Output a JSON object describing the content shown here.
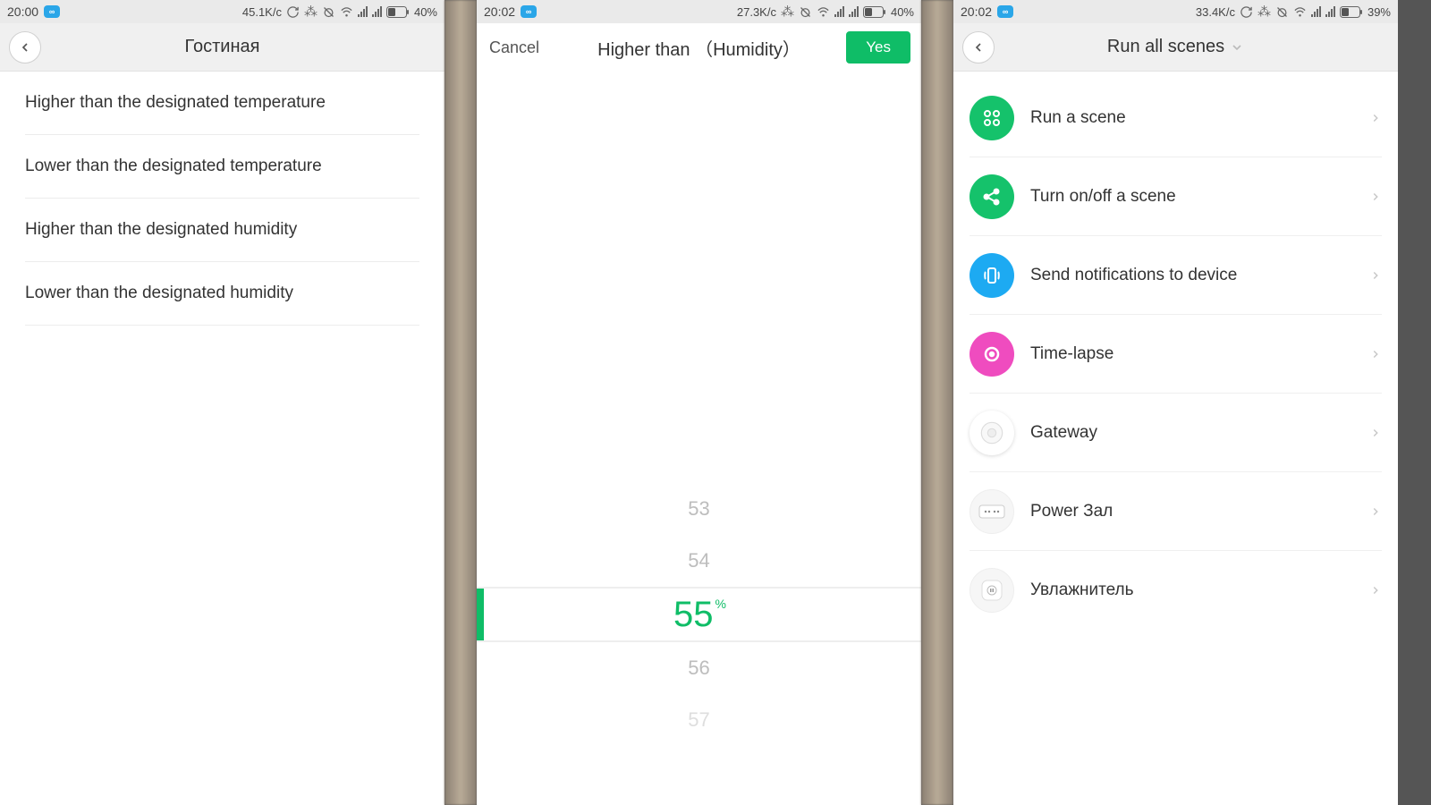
{
  "screen1": {
    "status": {
      "time": "20:00",
      "speed": "45.1K/c",
      "battery": "40%"
    },
    "title": "Гостиная",
    "options": [
      "Higher than the designated temperature",
      "Lower than the designated temperature",
      "Higher than the designated humidity",
      "Lower than the designated humidity"
    ]
  },
  "screen2": {
    "status": {
      "time": "20:02",
      "speed": "27.3K/c",
      "battery": "40%"
    },
    "cancel": "Cancel",
    "title": "Higher than （Humidity）",
    "confirm": "Yes",
    "picker": {
      "unit": "%",
      "values_above": [
        "53",
        "54"
      ],
      "selected": "55",
      "values_below": [
        "56",
        "57"
      ]
    }
  },
  "screen3": {
    "status": {
      "time": "20:02",
      "speed": "33.4K/c",
      "battery": "39%"
    },
    "title": "Run all scenes",
    "items": [
      {
        "label": "Run a scene",
        "icon": "scene"
      },
      {
        "label": "Turn on/off a scene",
        "icon": "share"
      },
      {
        "label": "Send notifications to device",
        "icon": "notify"
      },
      {
        "label": "Time-lapse",
        "icon": "time"
      },
      {
        "label": "Gateway",
        "icon": "gateway"
      },
      {
        "label": "Power Зал",
        "icon": "power"
      },
      {
        "label": "Увлажнитель",
        "icon": "plug"
      }
    ]
  }
}
